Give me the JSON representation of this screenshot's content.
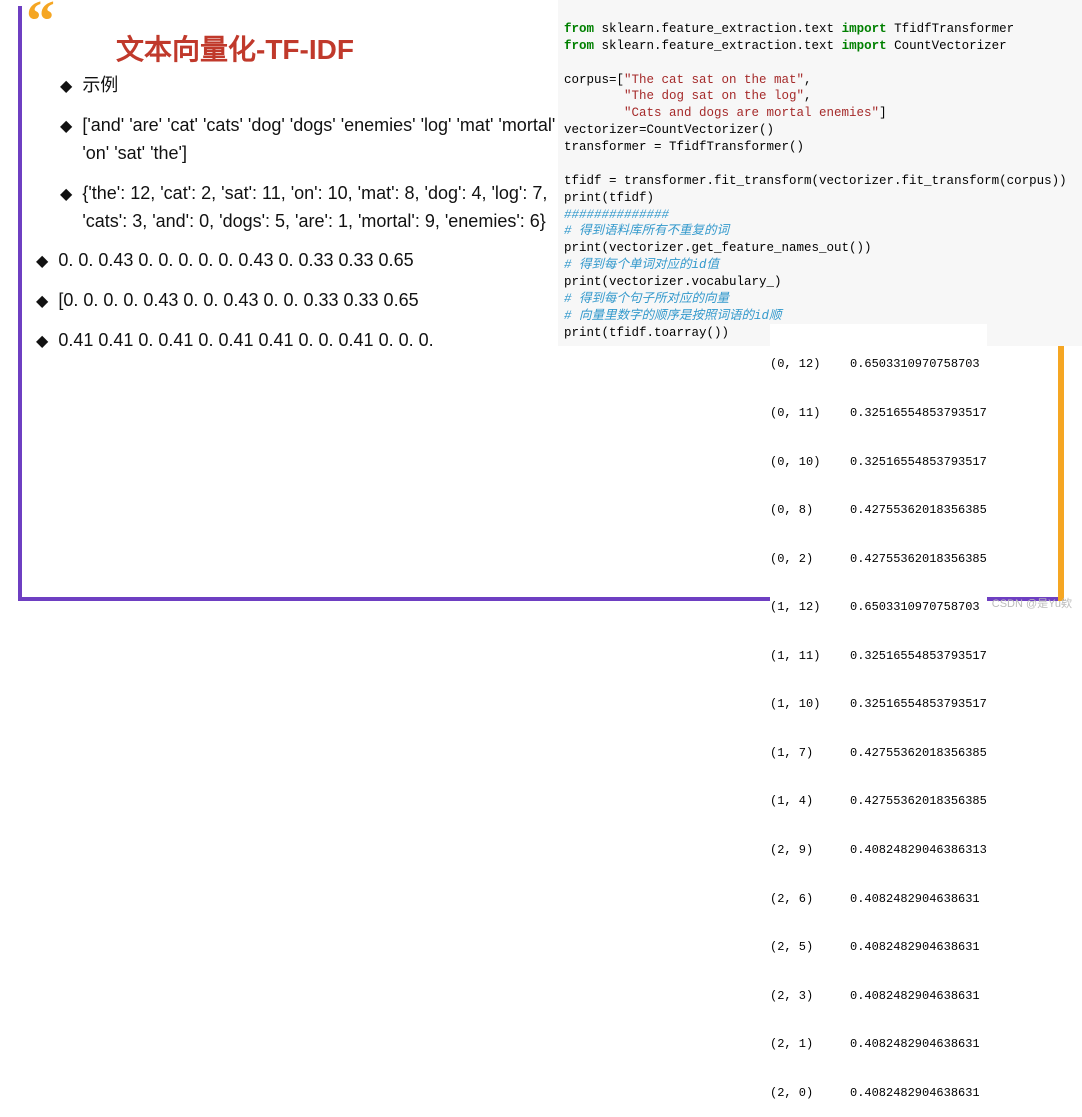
{
  "title": "文本向量化-TF-IDF",
  "bullets": {
    "b1": "示例",
    "b2": "['and' 'are' 'cat' 'cats' 'dog' 'dogs' 'enemies' 'log' 'mat' 'mortal' 'on' 'sat' 'the']",
    "b3": "{'the': 12, 'cat': 2, 'sat': 11, 'on': 10, 'mat': 8, 'dog': 4, 'log': 7, 'cats': 3, 'and': 0, 'dogs': 5, 'are': 1, 'mortal': 9, 'enemies': 6}",
    "b4": "0. 0. 0.43 0. 0. 0. 0. 0. 0.43 0. 0.33 0.33 0.65",
    "b5": "[0. 0. 0. 0. 0.43 0. 0. 0.43 0. 0. 0.33 0.33 0.65",
    "b6": "0.41 0.41 0. 0.41 0. 0.41  0.41 0. 0. 0.41 0. 0. 0."
  },
  "code": {
    "l1a": "from",
    "l1b": " sklearn.feature_extraction.text ",
    "l1c": "import",
    "l1d": " TfidfTransformer",
    "l2a": "from",
    "l2b": " sklearn.feature_extraction.text ",
    "l2c": "import",
    "l2d": " CountVectorizer",
    "l3": " ",
    "l4a": "corpus=[",
    "l4b": "\"The cat sat on the mat\"",
    "l4c": ",",
    "l5a": "        ",
    "l5b": "\"The dog sat on the log\"",
    "l5c": ",",
    "l6a": "        ",
    "l6b": "\"Cats and dogs are mortal enemies\"",
    "l6c": "]",
    "l7": "vectorizer=CountVectorizer()",
    "l8": "transformer = TfidfTransformer()",
    "l9": " ",
    "l10": "tfidf = transformer.fit_transform(vectorizer.fit_transform(corpus))",
    "l11": "print(tfidf)",
    "l12": "##############",
    "l13": "# 得到语料库所有不重复的词",
    "l14": "print(vectorizer.get_feature_names_out())",
    "l15": "# 得到每个单词对应的id值",
    "l16": "print(vectorizer.vocabulary_)",
    "l17": "# 得到每个句子所对应的向量",
    "l18": "# 向量里数字的顺序是按照词语的id顺",
    "l19": "print(tfidf.toarray())"
  },
  "output": [
    {
      "k": "(0, 12)",
      "v": "0.6503310970758703"
    },
    {
      "k": "(0, 11)",
      "v": "0.32516554853793517"
    },
    {
      "k": "(0, 10)",
      "v": "0.32516554853793517"
    },
    {
      "k": "(0, 8)",
      "v": "0.42755362018356385"
    },
    {
      "k": "(0, 2)",
      "v": "0.42755362018356385"
    },
    {
      "k": "(1, 12)",
      "v": "0.6503310970758703"
    },
    {
      "k": "(1, 11)",
      "v": "0.32516554853793517"
    },
    {
      "k": "(1, 10)",
      "v": "0.32516554853793517"
    },
    {
      "k": "(1, 7)",
      "v": "0.42755362018356385"
    },
    {
      "k": "(1, 4)",
      "v": "0.42755362018356385"
    },
    {
      "k": "(2, 9)",
      "v": "0.40824829046386313"
    },
    {
      "k": "(2, 6)",
      "v": "0.4082482904638631"
    },
    {
      "k": "(2, 5)",
      "v": "0.4082482904638631"
    },
    {
      "k": "(2, 3)",
      "v": "0.4082482904638631"
    },
    {
      "k": "(2, 1)",
      "v": "0.4082482904638631"
    },
    {
      "k": "(2, 0)",
      "v": "0.4082482904638631"
    }
  ],
  "watermark": "CSDN @是Yu欸"
}
